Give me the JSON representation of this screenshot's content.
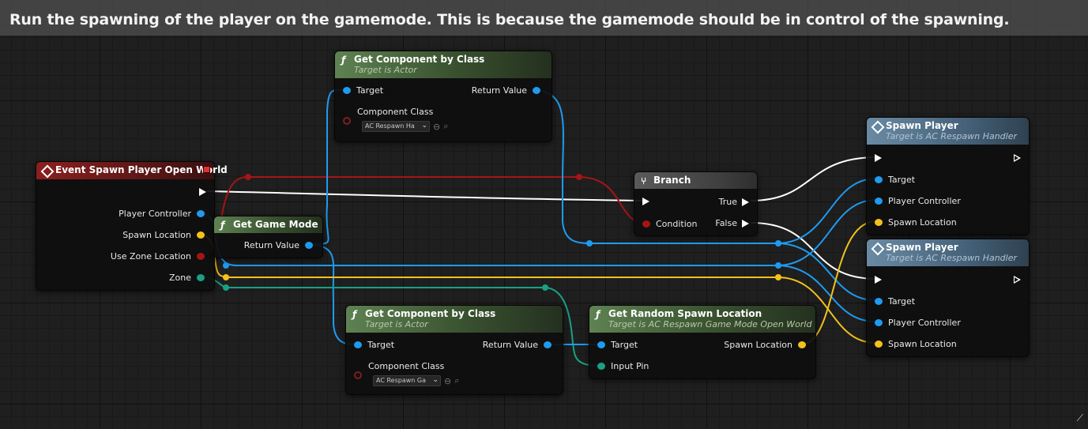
{
  "comment": {
    "text": "Run the spawning of the player on the gamemode. This is because the gamemode should be in control of the spawning."
  },
  "colors": {
    "object": "#1e9bf0",
    "vector": "#f2c21c",
    "bool": "#a51515",
    "struct": "#1aa085",
    "exec": "#ffffff"
  },
  "nodes": {
    "get_component_top": {
      "title": "Get Component by Class",
      "subtitle": "Target is Actor",
      "target": "Target",
      "return_value": "Return Value",
      "component_class": "Component Class",
      "class_value": "AC Respawn Ha"
    },
    "event": {
      "title": "Event Spawn Player Open World",
      "player_controller": "Player Controller",
      "spawn_location": "Spawn Location",
      "use_zone_location": "Use Zone Location",
      "zone": "Zone"
    },
    "get_game_mode": {
      "title": "Get Game Mode",
      "return_value": "Return Value"
    },
    "branch": {
      "title": "Branch",
      "true_label": "True",
      "false_label": "False",
      "condition": "Condition"
    },
    "spawn_player_1": {
      "title": "Spawn Player",
      "subtitle": "Target is AC Respawn Handler",
      "target": "Target",
      "player_controller": "Player Controller",
      "spawn_location": "Spawn Location"
    },
    "spawn_player_2": {
      "title": "Spawn Player",
      "subtitle": "Target is AC Respawn Handler",
      "target": "Target",
      "player_controller": "Player Controller",
      "spawn_location": "Spawn Location"
    },
    "get_component_bottom": {
      "title": "Get Component by Class",
      "subtitle": "Target is Actor",
      "target": "Target",
      "return_value": "Return Value",
      "component_class": "Component Class",
      "class_value": "AC Respawn Ga"
    },
    "get_random_spawn": {
      "title": "Get Random Spawn Location",
      "subtitle": "Target is AC Respawn Game Mode Open World",
      "target": "Target",
      "input_pin": "Input Pin",
      "spawn_location": "Spawn Location"
    }
  },
  "icons": {
    "function": "function-icon",
    "event": "event-diamond-icon",
    "branch": "branch-icon",
    "reset": "reset-arrow-icon",
    "browse": "magnifier-icon",
    "resize": "resize-grip-icon"
  }
}
